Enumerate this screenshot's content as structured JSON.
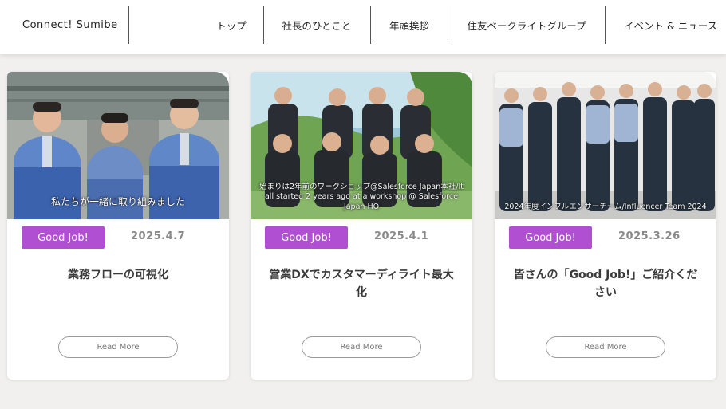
{
  "header": {
    "brand": "Connect! Sumibe",
    "nav": [
      "トップ",
      "社長のひとこと",
      "年頭挨拶",
      "住友ベークライトグループ",
      "イベント & ニュース"
    ]
  },
  "cards": [
    {
      "badge": "Good Job!",
      "date": "2025.4.7",
      "caption": "私たちが一緒に取り組みました",
      "title": "業務フローの可視化",
      "read_more": "Read More"
    },
    {
      "badge": "Good Job!",
      "date": "2025.4.1",
      "caption": "始まりは2年前のワークショップ@Salesforce Japan本社/It all started 2 years ago at a workshop @ Salesforce Japan HQ",
      "title": "営業DXでカスタマーディライト最大化",
      "read_more": "Read More"
    },
    {
      "badge": "Good Job!",
      "date": "2025.3.26",
      "caption": "2024年度インフルエンサーチーム/Influencer Team 2024",
      "title": "皆さんの「Good Job!」ご紹介ください",
      "read_more": "Read More"
    }
  ],
  "colors": {
    "badge": "#b14fd2",
    "page_bg": "#f1f0ef",
    "date": "#8a8a8a"
  }
}
